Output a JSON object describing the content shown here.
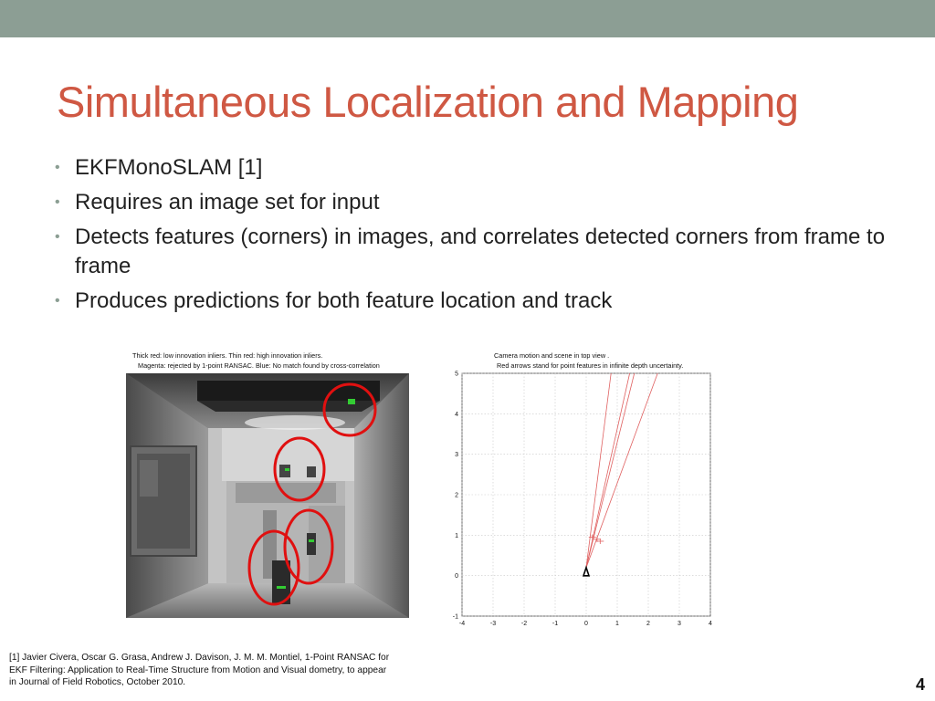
{
  "slide": {
    "title": "Simultaneous Localization and Mapping",
    "page_number": "4"
  },
  "bullets": [
    {
      "text": "EKFMonoSLAM [1]"
    },
    {
      "text": "Requires an image set for input"
    },
    {
      "text": "Detects features (corners) in images, and correlates detected corners from frame to frame"
    },
    {
      "text": "Produces predictions for both feature location and track"
    }
  ],
  "figure": {
    "left_caption": [
      "Thick red: low innovation inliers. Thin red: high innovation inliers.",
      "Magenta: rejected by 1-point RANSAC. Blue: No match found by cross-correlation"
    ],
    "right_caption": [
      "Camera motion and scene in top view .",
      "Red arrows stand for point features in infinite depth uncertainty."
    ]
  },
  "chart_data": {
    "type": "line",
    "title": "Camera motion and scene in top view . Red arrows stand for point features in infinite depth uncertainty.",
    "xlim": [
      -4,
      4
    ],
    "ylim": [
      -1,
      5
    ],
    "x_ticks": [
      -4,
      -3,
      -2,
      -1,
      0,
      1,
      2,
      3,
      4
    ],
    "y_ticks": [
      -1,
      0,
      1,
      2,
      3,
      4,
      5
    ],
    "grid": true,
    "camera_position": {
      "x": 0,
      "y": 0.2
    },
    "feature_rays": [
      {
        "from": [
          0,
          0.2
        ],
        "to": [
          0.8,
          5
        ]
      },
      {
        "from": [
          0,
          0.2
        ],
        "to": [
          1.4,
          5
        ]
      },
      {
        "from": [
          0,
          0.2
        ],
        "to": [
          1.55,
          5
        ]
      },
      {
        "from": [
          0,
          0.2
        ],
        "to": [
          2.3,
          5
        ]
      }
    ],
    "feature_markers": [
      {
        "x": 0.2,
        "y": 0.95
      },
      {
        "x": 0.35,
        "y": 0.9
      },
      {
        "x": 0.45,
        "y": 0.85
      }
    ]
  },
  "footnote": "[1] Javier Civera, Oscar G. Grasa, Andrew J. Davison, J. M. M. Montiel, 1-Point RANSAC for EKF Filtering: Application to Real-Time Structure from Motion and Visual dometry,   to appear in Journal of Field Robotics, October 2010.",
  "colors": {
    "header_bar": "#8c9e94",
    "title": "#cf5843",
    "bullet": "#8b9e93",
    "highlight_circle": "#e01010",
    "ray": "#e06060"
  }
}
